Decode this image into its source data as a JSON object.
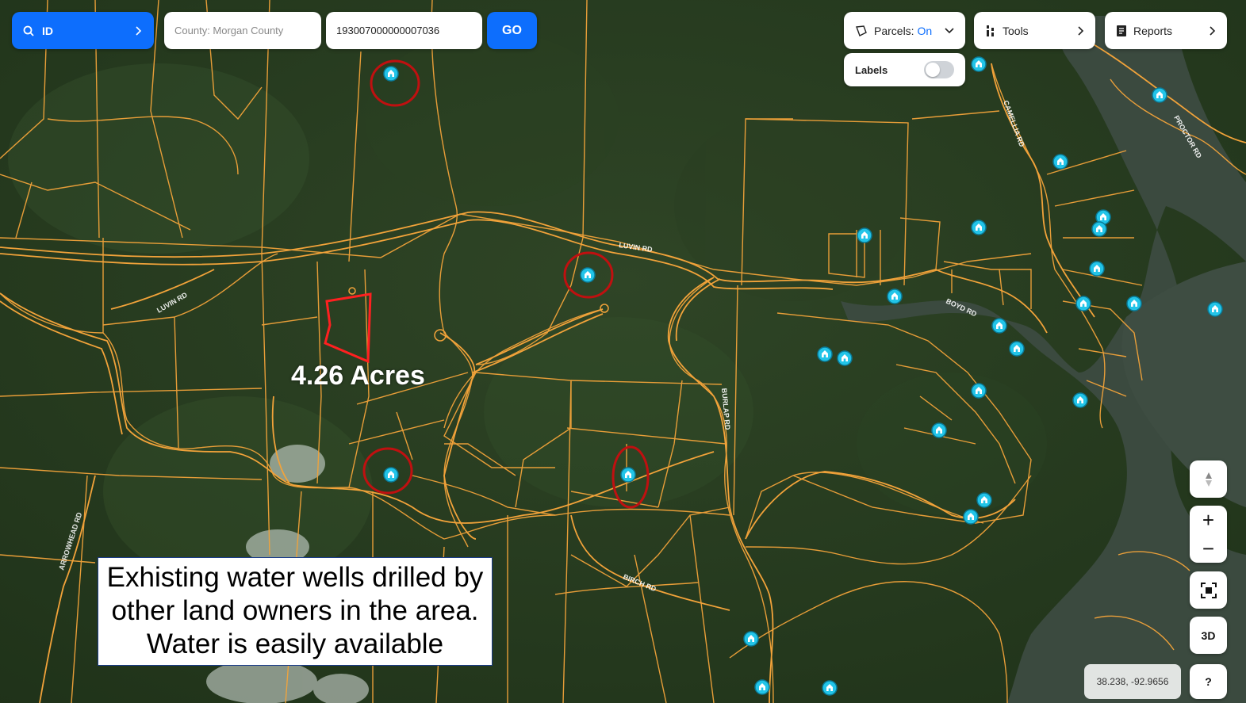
{
  "search": {
    "mode_label": "ID",
    "county_placeholder": "County: Morgan County",
    "parcel_id_value": "193007000000007036",
    "go_label": "GO"
  },
  "toolbar": {
    "parcels_label": "Parcels:",
    "parcels_state": "On",
    "tools_label": "Tools",
    "reports_label": "Reports",
    "labels_toggle_label": "Labels",
    "labels_toggle_on": false
  },
  "map": {
    "roads": [
      "LUVIN RD",
      "LUVIN RD",
      "CAMELLIA RD",
      "PROCTOR RD",
      "BOYD RD",
      "BURLAP RD",
      "BIRCH RD",
      "ARROWHEAD RD"
    ],
    "parcel_label": "4.26 Acres",
    "annotation_lines": [
      "Exhisting water wells drilled by",
      "other land owners in the area.",
      "Water is easily available"
    ],
    "colors": {
      "parcel_lines": "#f2a33a",
      "selected_parcel": "#ff2020",
      "highlight_circle": "#c01010",
      "well_marker": "#22c4e8",
      "water": "#3a4a3e"
    }
  },
  "controls": {
    "compass_label": "▲▼",
    "zoom_in": "+",
    "zoom_out": "−",
    "three_d_label": "3D",
    "help_label": "?",
    "coordinates": "38.238, -92.9656"
  }
}
